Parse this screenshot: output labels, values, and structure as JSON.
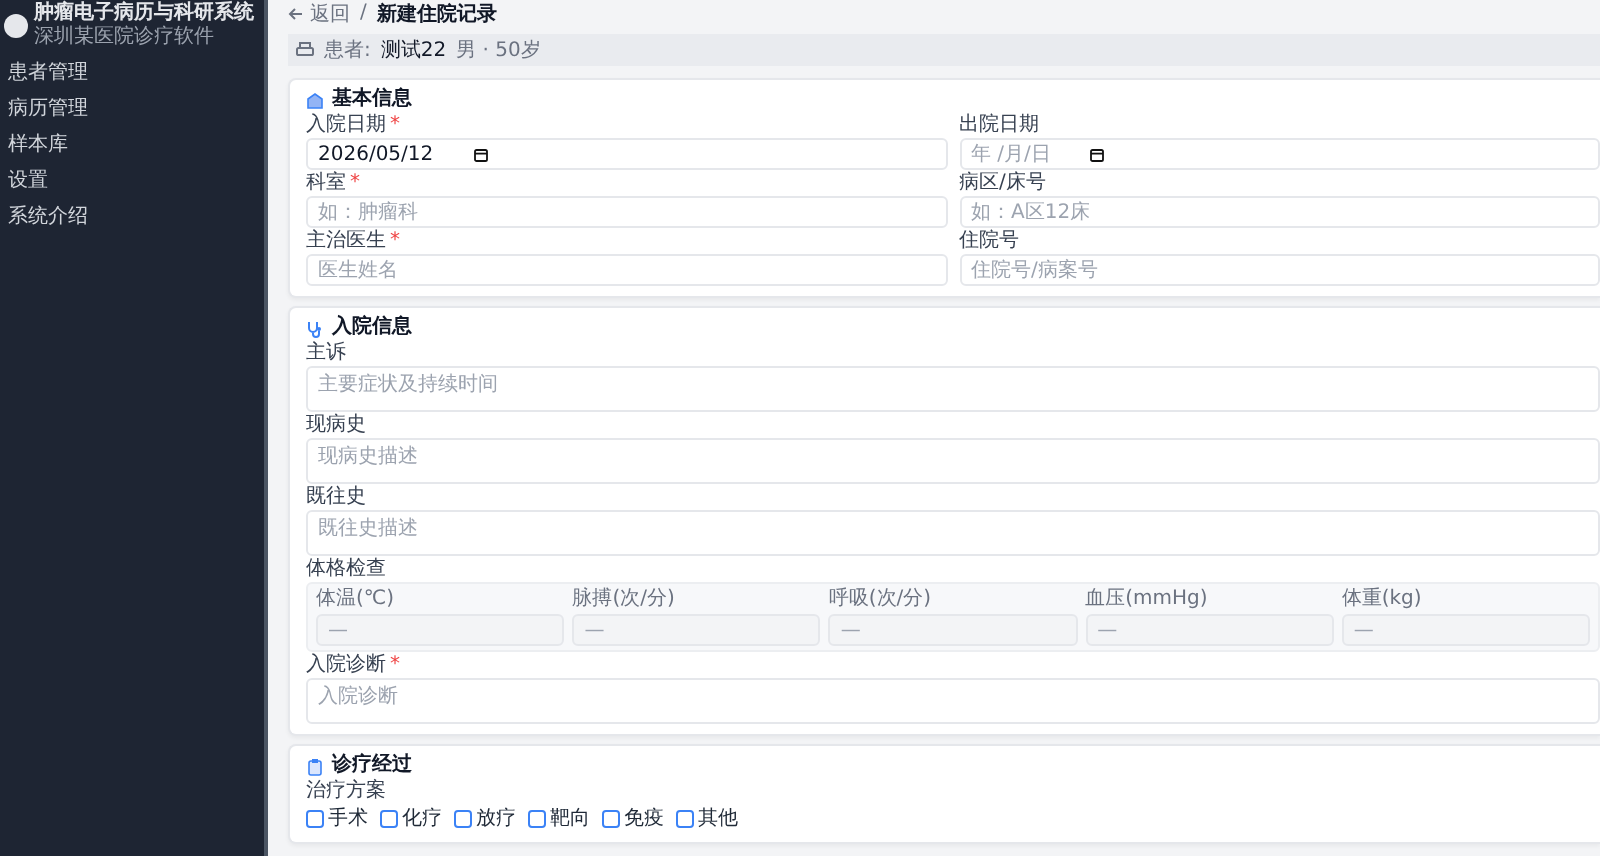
{
  "sidebar": {
    "title": "肿瘤电子病历与科研系统",
    "subtitle": "深圳某医院诊疗软件",
    "items": [
      {
        "label": "患者管理",
        "selected": false
      },
      {
        "label": "病历管理",
        "selected": false
      },
      {
        "label": "样本库",
        "selected": false
      },
      {
        "label": "设置",
        "selected": false
      },
      {
        "label": "系统介绍",
        "selected": false
      }
    ]
  },
  "header": {
    "back": "返回",
    "separator": "/",
    "title": "新建住院记录"
  },
  "patient_bar": {
    "label": "患者:",
    "name": "测试22",
    "info": "男 · 50岁"
  },
  "sections": [
    {
      "title": "基本信息",
      "fields": [
        {
          "label": "入院日期",
          "required_mark": "*",
          "kind": "date",
          "value": "2026/05/12"
        },
        {
          "label": "出院日期",
          "kind": "date",
          "placeholder": "年 /月/日"
        },
        {
          "label": "科室",
          "required_mark": "*",
          "kind": "text",
          "placeholder": "如：肿瘤科"
        },
        {
          "label": "病区/床号",
          "kind": "text",
          "placeholder": "如：A区12床"
        },
        {
          "label": "主治医生",
          "required_mark": "*",
          "kind": "text",
          "placeholder": "医生姓名"
        },
        {
          "label": "住院号",
          "kind": "text",
          "placeholder": "住院号/病案号"
        }
      ]
    },
    {
      "title": "入院信息",
      "fields": [
        {
          "label": "主诉",
          "kind": "textarea",
          "placeholder": "主要症状及持续时间"
        },
        {
          "label": "现病史",
          "kind": "textarea",
          "placeholder": "现病史描述"
        },
        {
          "label": "既往史",
          "kind": "textarea",
          "placeholder": "既往史描述"
        },
        {
          "label": "体格检查",
          "kind": "vitals",
          "items": [
            {
              "label": "体温(℃)",
              "placeholder": "—"
            },
            {
              "label": "脉搏(次/分)",
              "placeholder": "—"
            },
            {
              "label": "呼吸(次/分)",
              "placeholder": "—"
            },
            {
              "label": "血压(mmHg)",
              "placeholder": "—"
            },
            {
              "label": "体重(kg)",
              "placeholder": "—"
            }
          ]
        },
        {
          "label": "入院诊断",
          "required_mark": "*",
          "kind": "textarea",
          "placeholder": "入院诊断"
        }
      ]
    },
    {
      "title": "诊疗经过",
      "fields": [
        {
          "label": "治疗方案",
          "kind": "checks",
          "options": [
            {
              "label": "手术",
              "checked": false
            },
            {
              "label": "化疗",
              "checked": false
            },
            {
              "label": "放疗",
              "checked": false
            },
            {
              "label": "靶向",
              "checked": false
            },
            {
              "label": "免疫",
              "checked": false
            },
            {
              "label": "其他",
              "checked": false
            }
          ]
        }
      ]
    }
  ]
}
